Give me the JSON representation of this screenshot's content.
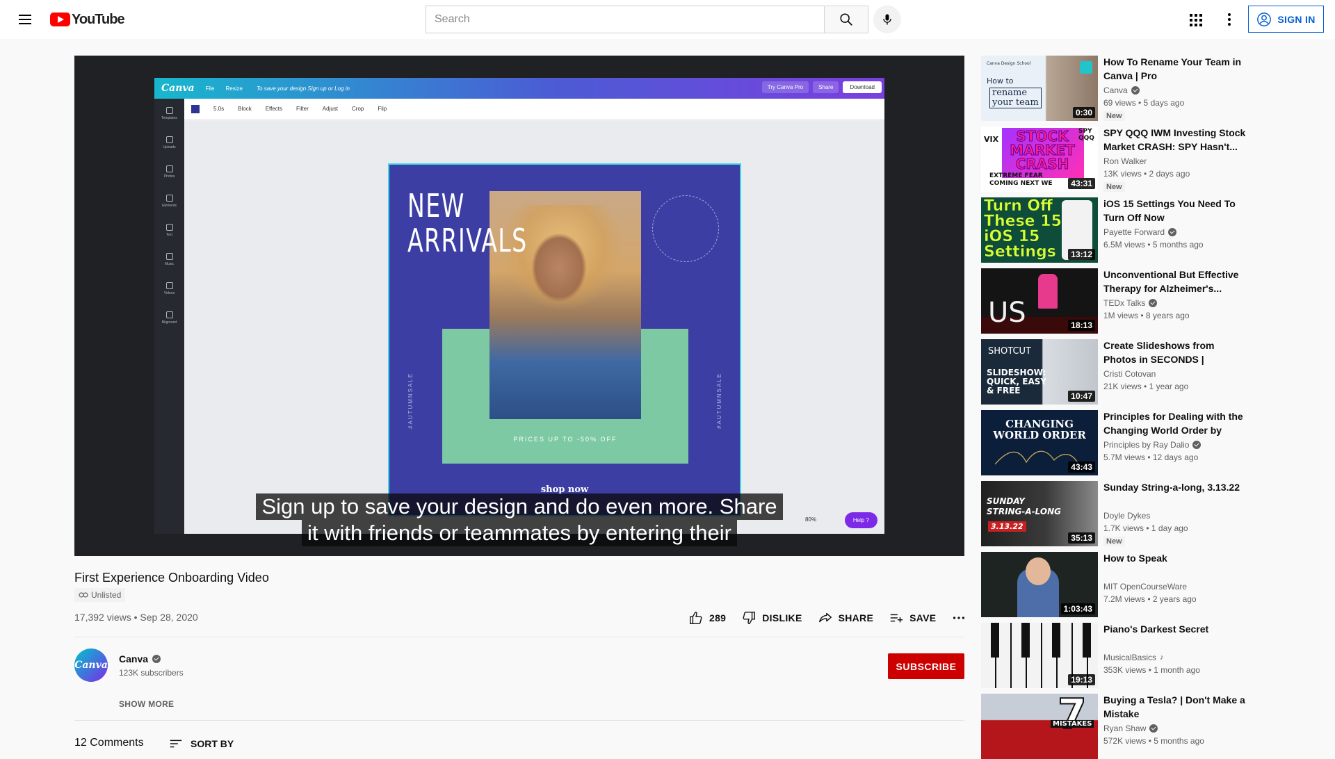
{
  "header": {
    "logo_text": "YouTube",
    "search_placeholder": "Search",
    "signin_label": "SIGN IN"
  },
  "player": {
    "captions": [
      "Sign up to save your design and do even more. Share",
      "it with friends or teammates by entering their"
    ],
    "canva": {
      "brand": "Canva",
      "menu": [
        "File",
        "Resize"
      ],
      "hint": "To save your design Sign up or Log in",
      "try_pro": "Try Canva Pro",
      "share": "Share",
      "download": "Download",
      "toolbar": [
        "5.0s",
        "Block",
        "Effects",
        "Filter",
        "Adjust",
        "Crop",
        "Flip"
      ],
      "side_items": [
        "Templates",
        "Uploads",
        "Photos",
        "Elements",
        "Text",
        "Music",
        "Videos",
        "Bkground"
      ],
      "design_headline": [
        "NEW",
        "ARRIVALS"
      ],
      "design_prices": "PRICES UP TO -50% OFF",
      "design_shop": "shop now",
      "design_vertical": "#AUTUMNSALE",
      "design_circle": "SALE · SALE · SALE ·",
      "zoom": "80%",
      "help": "Help ?"
    }
  },
  "video": {
    "title": "First Experience Onboarding Video",
    "unlisted_label": "Unlisted",
    "meta": "17,392 views • Sep 28, 2020",
    "likes": "289",
    "dislike_label": "DISLIKE",
    "share_label": "SHARE",
    "save_label": "SAVE"
  },
  "channel": {
    "name": "Canva",
    "avatar_text": "Canva",
    "subscribers": "123K subscribers",
    "subscribe_label": "SUBSCRIBE",
    "show_more_label": "SHOW MORE"
  },
  "comments": {
    "count_label": "12 Comments",
    "sort_label": "SORT BY"
  },
  "related": [
    {
      "title": "How To Rename Your Team in Canva | Pro",
      "channel": "Canva",
      "verified": true,
      "meta": "69 views • 5 days ago",
      "badge": "New",
      "duration": "0:30",
      "thumb_text": [
        "How to",
        "rename",
        "your team"
      ],
      "thumb_caption": "Canva Design School"
    },
    {
      "title": "SPY QQQ IWM Investing Stock Market CRASH: SPY Hasn't...",
      "channel": "Ron Walker",
      "verified": false,
      "meta": "13K views • 2 days ago",
      "badge": "New",
      "duration": "43:31",
      "thumb_text": [
        "STOCK",
        "MARKET",
        "CRASH"
      ],
      "thumb_caption": "EXTREME FEAR COMING NEXT WE",
      "thumb_tags": [
        "VIX",
        "SPY",
        "QQQ"
      ]
    },
    {
      "title": "iOS 15 Settings You Need To Turn Off Now",
      "channel": "Payette Forward",
      "verified": true,
      "meta": "6.5M views • 5 months ago",
      "badge": "",
      "duration": "13:12",
      "thumb_text": [
        "Turn Off",
        "These 15",
        "iOS 15",
        "Settings"
      ]
    },
    {
      "title": "Unconventional But Effective Therapy for Alzheimer's...",
      "channel": "TEDx Talks",
      "verified": true,
      "meta": "1M views • 8 years ago",
      "badge": "",
      "duration": "18:13",
      "thumb_text": [
        "US"
      ]
    },
    {
      "title": "Create Slideshows from Photos in SECONDS | Quickest, Easies...",
      "channel": "Cristi Cotovan",
      "verified": false,
      "meta": "21K views • 1 year ago",
      "badge": "",
      "duration": "10:47",
      "thumb_text": [
        "SHOTCUT",
        "SLIDESHOW:",
        "QUICK, EASY",
        "& FREE"
      ]
    },
    {
      "title": "Principles for Dealing with the Changing World Order by Ray...",
      "channel": "Principles by Ray Dalio",
      "verified": true,
      "meta": "5.7M views • 12 days ago",
      "badge": "",
      "duration": "43:43",
      "thumb_text": [
        "CHANGING",
        "WORLD ORDER"
      ]
    },
    {
      "title": "Sunday String-a-long, 3.13.22",
      "channel": "Doyle Dykes",
      "verified": false,
      "meta": "1.7K views • 1 day ago",
      "badge": "New",
      "duration": "35:13",
      "thumb_text": [
        "SUNDAY",
        "STRING-A-LONG",
        "3.13.22"
      ]
    },
    {
      "title": "How to Speak",
      "channel": "MIT OpenCourseWare",
      "verified": false,
      "meta": "7.2M views • 2 years ago",
      "badge": "",
      "duration": "1:03:43"
    },
    {
      "title": "Piano's Darkest Secret",
      "channel": "MusicalBasics",
      "verified": false,
      "music": true,
      "meta": "353K views • 1 month ago",
      "badge": "",
      "duration": "19:13"
    },
    {
      "title": "Buying a Tesla? | Don't Make a Mistake",
      "channel": "Ryan Shaw",
      "verified": true,
      "meta": "572K views • 5 months ago",
      "badge": "",
      "duration": "",
      "thumb_text": [
        "7",
        "MISTAKES"
      ]
    }
  ]
}
